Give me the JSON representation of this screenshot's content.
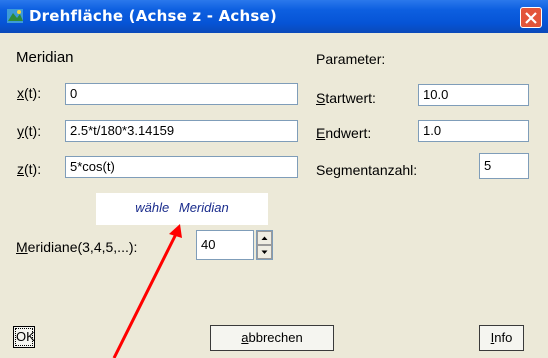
{
  "window": {
    "title": "Drehfläche (Achse z - Achse)"
  },
  "meridian": {
    "heading": "Meridian",
    "x_label": "x(t):",
    "x_value": "0",
    "y_label": "y(t):",
    "y_value": "2.5*t/180*3.14159",
    "z_label": "z(t):",
    "z_value": "5*cos(t)",
    "select_button": "wähle Meridian",
    "count_label": "Meridiane(3,4,5,...):",
    "count_value": "40"
  },
  "parameter": {
    "heading": "Parameter:",
    "start_label": "Startwert:",
    "start_value": "10.0",
    "end_label": "Endwert:",
    "end_value": "1.0",
    "segments_label": "Segmentanzahl:",
    "segments_value": "5"
  },
  "buttons": {
    "ok": "OK",
    "cancel": "abbrechen",
    "info": "Info"
  },
  "colors": {
    "titlebar": "#0654d6",
    "annotation_arrow": "#ff0000",
    "meridian_text": "#1a2c8c"
  }
}
